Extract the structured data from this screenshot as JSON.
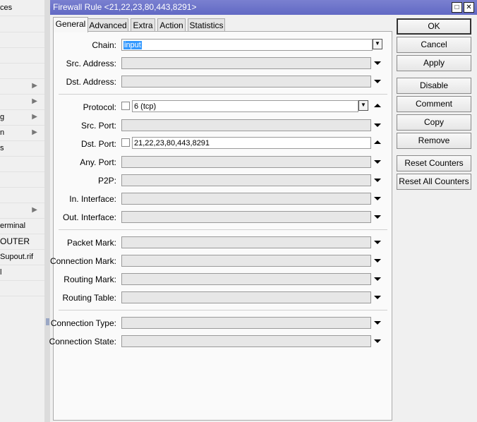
{
  "sidebar": {
    "items": [
      "ces",
      "",
      "",
      "",
      "",
      "",
      "g",
      "n",
      "s",
      "",
      "",
      "",
      "",
      "erminal",
      "OUTER",
      "Supout.rif",
      "l",
      ""
    ]
  },
  "window": {
    "title": "Firewall Rule <21,22,23,80,443,8291>",
    "title_buttons": [
      "□",
      "✕"
    ]
  },
  "tabs": [
    "General",
    "Advanced",
    "Extra",
    "Action",
    "Statistics"
  ],
  "form": {
    "chain": {
      "label": "Chain:",
      "value": "input"
    },
    "src_address": {
      "label": "Src. Address:",
      "value": ""
    },
    "dst_address": {
      "label": "Dst. Address:",
      "value": ""
    },
    "protocol": {
      "label": "Protocol:",
      "value": "6 (tcp)"
    },
    "src_port": {
      "label": "Src. Port:",
      "value": ""
    },
    "dst_port": {
      "label": "Dst. Port:",
      "value": "21,22,23,80,443,8291"
    },
    "any_port": {
      "label": "Any. Port:",
      "value": ""
    },
    "p2p": {
      "label": "P2P:",
      "value": ""
    },
    "in_interface": {
      "label": "In. Interface:",
      "value": ""
    },
    "out_interface": {
      "label": "Out. Interface:",
      "value": ""
    },
    "packet_mark": {
      "label": "Packet Mark:",
      "value": ""
    },
    "connection_mark": {
      "label": "Connection Mark:",
      "value": ""
    },
    "routing_mark": {
      "label": "Routing Mark:",
      "value": ""
    },
    "routing_table": {
      "label": "Routing Table:",
      "value": ""
    },
    "connection_type": {
      "label": "Connection Type:",
      "value": ""
    },
    "connection_state": {
      "label": "Connection State:",
      "value": ""
    }
  },
  "buttons": {
    "ok": "OK",
    "cancel": "Cancel",
    "apply": "Apply",
    "disable": "Disable",
    "comment": "Comment",
    "copy": "Copy",
    "remove": "Remove",
    "reset_counters": "Reset Counters",
    "reset_all_counters": "Reset All Counters"
  },
  "colors": {
    "titlebar": "#6169c4",
    "selection": "#3399ff"
  }
}
